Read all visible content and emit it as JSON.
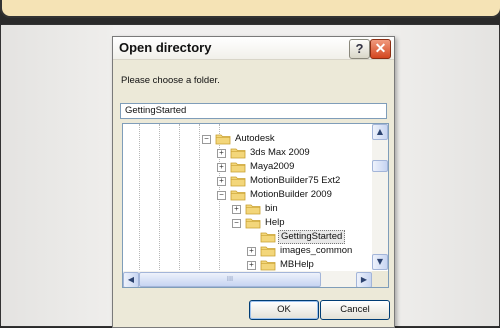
{
  "dialog": {
    "title": "Open directory",
    "prompt": "Please choose a folder.",
    "path_value": "GettingStarted",
    "help_label": "?",
    "close_label": "✕",
    "ok_label": "OK",
    "cancel_label": "Cancel"
  },
  "tree": {
    "items": [
      {
        "label": "Autodesk",
        "expander": "−",
        "selected": false
      },
      {
        "label": "3ds Max 2009",
        "expander": "+",
        "selected": false
      },
      {
        "label": "Maya2009",
        "expander": "+",
        "selected": false
      },
      {
        "label": "MotionBuilder75 Ext2",
        "expander": "+",
        "selected": false
      },
      {
        "label": "MotionBuilder 2009",
        "expander": "−",
        "selected": false
      },
      {
        "label": "bin",
        "expander": "+",
        "selected": false
      },
      {
        "label": "Help",
        "expander": "−",
        "selected": false
      },
      {
        "label": "GettingStarted",
        "expander": "",
        "selected": true
      },
      {
        "label": "images_common",
        "expander": "+",
        "selected": false
      },
      {
        "label": "MBHelp",
        "expander": "+",
        "selected": false
      }
    ]
  },
  "scroll": {
    "up": "▲",
    "down": "▼",
    "left": "◀",
    "right": "▶",
    "grip": "III"
  },
  "colors": {
    "folder_body": "#f3d67a",
    "folder_edge": "#c9a030",
    "title_bg": "#ffffff",
    "close_red": "#d3461f"
  }
}
